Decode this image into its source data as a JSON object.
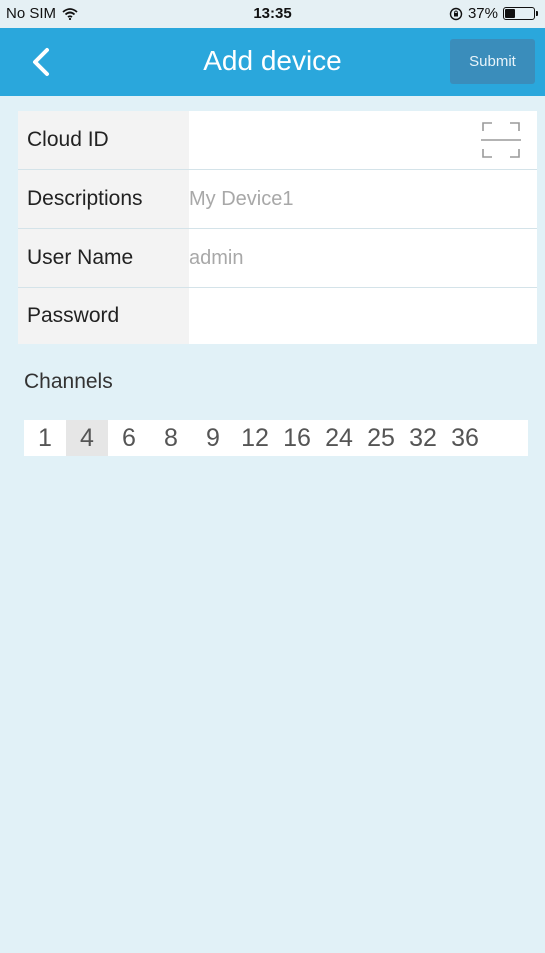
{
  "status_bar": {
    "carrier": "No SIM",
    "time": "13:35",
    "battery_text": "37%",
    "battery_level": 0.37
  },
  "nav": {
    "title": "Add device",
    "submit_label": "Submit"
  },
  "form": {
    "cloud_id": {
      "label": "Cloud ID",
      "value": "",
      "placeholder": ""
    },
    "descriptions": {
      "label": "Descriptions",
      "value": "",
      "placeholder": "My Device1"
    },
    "user_name": {
      "label": "User Name",
      "value": "",
      "placeholder": "admin"
    },
    "password": {
      "label": "Password",
      "value": "",
      "placeholder": ""
    }
  },
  "channels": {
    "label": "Channels",
    "options": [
      "1",
      "4",
      "6",
      "8",
      "9",
      "12",
      "16",
      "24",
      "25",
      "32",
      "36"
    ],
    "selected": "4"
  },
  "icons": {
    "back": "chevron-left-icon",
    "scan": "qr-scan-icon",
    "wifi": "wifi-icon",
    "orientation_lock": "orientation-lock-icon",
    "battery": "battery-icon"
  },
  "colors": {
    "nav_background": "#2aa7dc",
    "submit_background": "#3a8dbb",
    "page_background": "#e1f1f7",
    "selected_channel": "#e6e6e6"
  }
}
